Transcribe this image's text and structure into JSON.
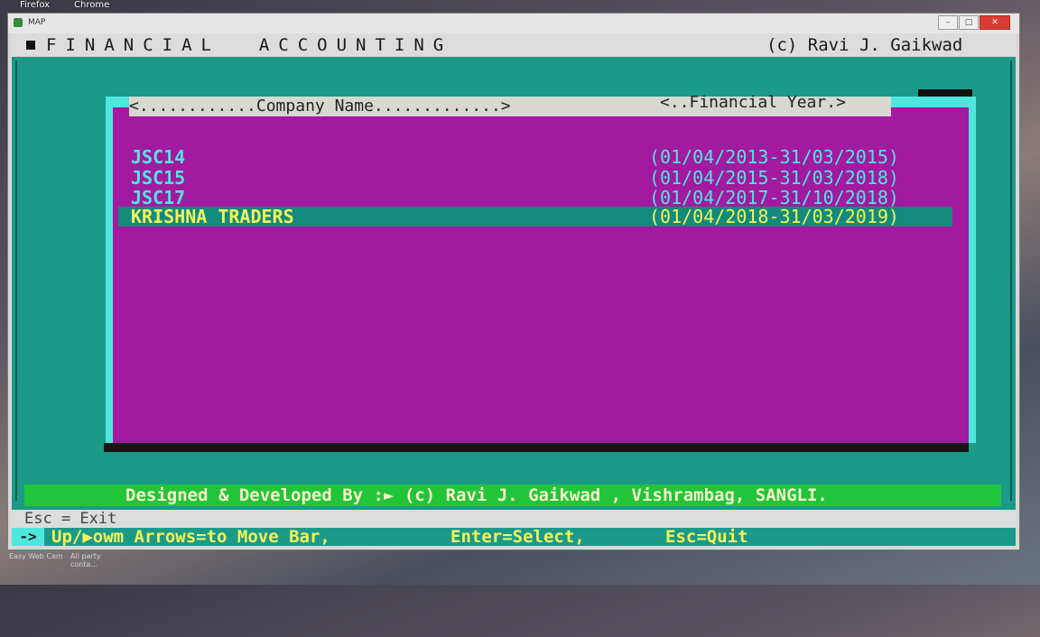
{
  "desktop": {
    "top_icons": [
      "Firefox",
      "Chrome"
    ],
    "bottom_icons": [
      "Easy Web Cam",
      "All party conta..."
    ]
  },
  "window": {
    "title": "MAP",
    "controls": {
      "minimize": "–",
      "maximize": "□",
      "close": "✕"
    }
  },
  "app": {
    "header_title": "FINANCIAL  ACCOUNTING",
    "header_copyright": "(c) Ravi J. Gaikwad",
    "columns": {
      "company": "<............Company Name.............>",
      "year": "<..Financial Year.>"
    },
    "companies": [
      {
        "name": "JSC14",
        "year": "(01/04/2013-31/03/2015)",
        "selected": false
      },
      {
        "name": "JSC15",
        "year": "(01/04/2015-31/03/2018)",
        "selected": false
      },
      {
        "name": "JSC17",
        "year": "(01/04/2017-31/10/2018)",
        "selected": false
      },
      {
        "name": "KRISHNA TRADERS",
        "year": "(01/04/2018-31/03/2019)",
        "selected": true
      }
    ],
    "designed_by": "Designed & Developed By :► (c) Ravi J. Gaikwad , Vishrambag, SANGLI.",
    "status_exit": "Esc = Exit",
    "arrow": "->",
    "hints": {
      "move": "Up/▶owm Arrows=to Move Bar,",
      "select": "Enter=Select,",
      "quit": "Esc=Quit"
    },
    "colors": {
      "panel": "#a21aa0",
      "console": "#1b9a8a",
      "cyan": "#4ee7e0",
      "highlight_text": "#f4f45a",
      "banner": "#22c43a"
    }
  }
}
